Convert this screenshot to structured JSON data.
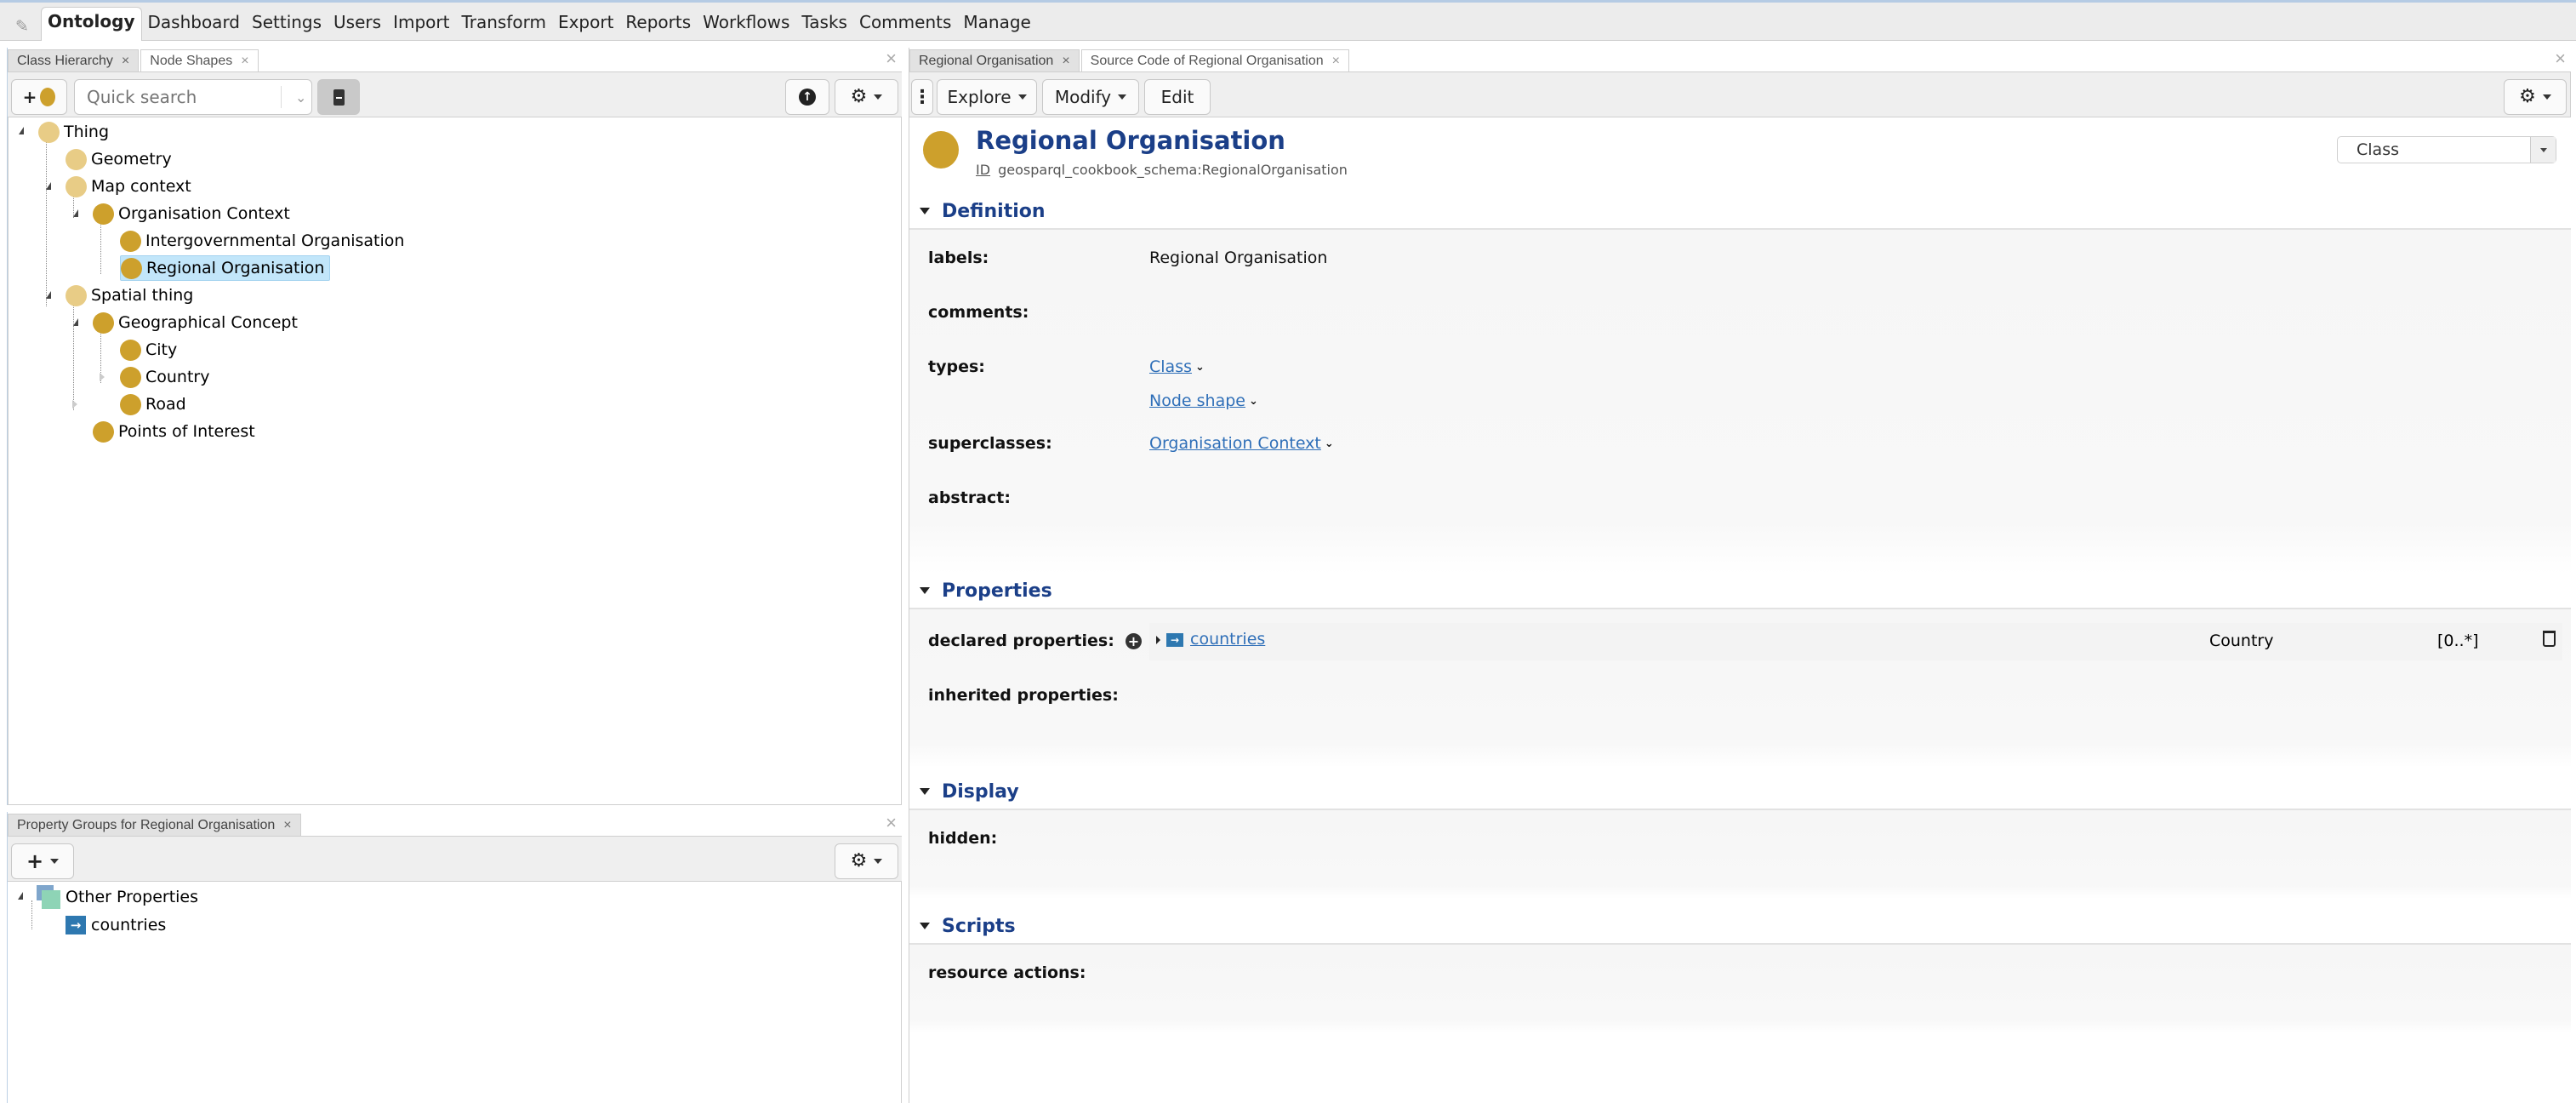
{
  "topbar": {
    "edit_icon": "pencil-icon",
    "menu": [
      "Ontology",
      "Dashboard",
      "Settings",
      "Users",
      "Import",
      "Transform",
      "Export",
      "Reports",
      "Workflows",
      "Tasks",
      "Comments",
      "Manage"
    ],
    "active": "Ontology"
  },
  "left_panel": {
    "tabs": [
      {
        "label": "Class Hierarchy",
        "active": true
      },
      {
        "label": "Node Shapes",
        "active": false
      }
    ],
    "close": "×",
    "toolbar": {
      "add_class": "+",
      "search_placeholder": "Quick search",
      "icons": [
        "book-icon",
        "arrow-up-circle-icon",
        "gear-icon"
      ]
    },
    "tree": [
      {
        "label": "Thing",
        "level": 0,
        "style": "light",
        "expanded": true
      },
      {
        "label": "Geometry",
        "level": 1,
        "style": "light"
      },
      {
        "label": "Map context",
        "level": 1,
        "style": "light",
        "expanded": true
      },
      {
        "label": "Organisation Context",
        "level": 2,
        "style": "dark",
        "expanded": true
      },
      {
        "label": "Intergovernmental Organisation",
        "level": 3,
        "style": "dark"
      },
      {
        "label": "Regional Organisation",
        "level": 3,
        "style": "dark",
        "selected": true
      },
      {
        "label": "Spatial thing",
        "level": 1,
        "style": "light",
        "expanded": true
      },
      {
        "label": "Geographical Concept",
        "level": 2,
        "style": "dark",
        "expanded": true
      },
      {
        "label": "City",
        "level": 3,
        "style": "dark"
      },
      {
        "label": "Country",
        "level": 3,
        "style": "dark"
      },
      {
        "label": "Road",
        "level": 3,
        "style": "dark",
        "collapsed": true
      },
      {
        "label": "Points of Interest",
        "level": 2,
        "style": "dark",
        "collapsed": true
      }
    ]
  },
  "bottom_panel": {
    "tab": "Property Groups for Regional Organisation",
    "close": "×",
    "toolbar": {
      "add": "+"
    },
    "tree": [
      {
        "label": "Other Properties",
        "icon": "property-group-icon"
      },
      {
        "label": "countries",
        "icon": "object-property-icon"
      }
    ]
  },
  "right_panel": {
    "tabs": [
      {
        "label": "Regional Organisation",
        "active": true
      },
      {
        "label": "Source Code of Regional Organisation",
        "active": false
      }
    ],
    "close": "×",
    "toolbar": {
      "explore": "Explore",
      "modify": "Modify",
      "edit": "Edit"
    },
    "header": {
      "title": "Regional Organisation",
      "id_label": "ID",
      "id_value": "geosparql_cookbook_schema:RegionalOrganisation",
      "type_select": "Class"
    },
    "sections": {
      "definition": {
        "title": "Definition",
        "labels_label": "labels:",
        "labels_value": "Regional Organisation",
        "comments_label": "comments:",
        "types_label": "types:",
        "types": [
          "Class",
          "Node shape"
        ],
        "superclasses_label": "superclasses:",
        "superclasses": [
          "Organisation Context"
        ],
        "abstract_label": "abstract:"
      },
      "properties": {
        "title": "Properties",
        "declared_label": "declared properties:",
        "declared": [
          {
            "name": "countries",
            "range": "Country",
            "cardinality": "[0..*]"
          }
        ],
        "inherited_label": "inherited properties:"
      },
      "display": {
        "title": "Display",
        "hidden_label": "hidden:"
      },
      "scripts": {
        "title": "Scripts",
        "resource_actions_label": "resource actions:"
      }
    }
  }
}
